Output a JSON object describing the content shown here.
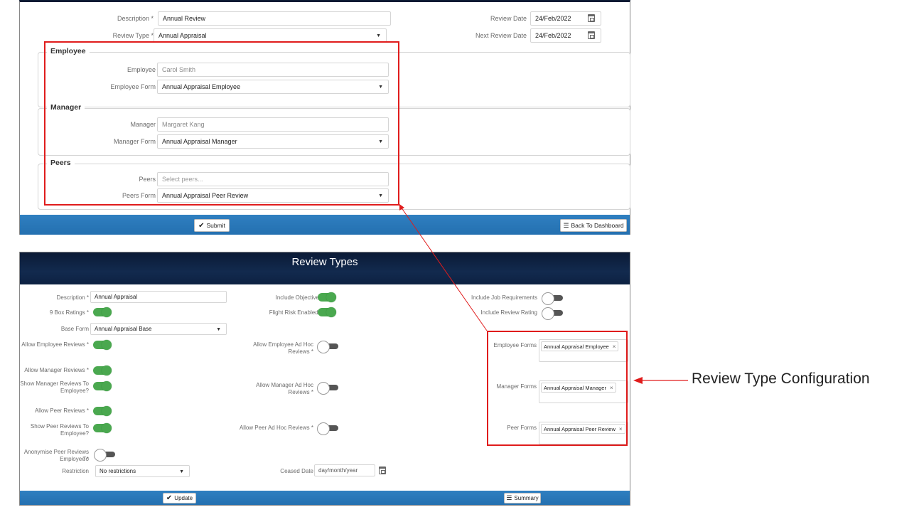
{
  "top_form": {
    "description_label": "Description *",
    "description_value": "Annual Review",
    "review_type_label": "Review Type *",
    "review_type_value": "Annual Appraisal",
    "review_date_label": "Review Date",
    "review_date_value": "24/Feb/2022",
    "next_review_date_label": "Next Review Date",
    "next_review_date_value": "24/Feb/2022",
    "employee_section": {
      "legend": "Employee",
      "employee_label": "Employee",
      "employee_value": "Carol Smith",
      "form_label": "Employee Form",
      "form_value": "Annual Appraisal Employee"
    },
    "manager_section": {
      "legend": "Manager",
      "manager_label": "Manager",
      "manager_value": "Margaret Kang",
      "form_label": "Manager Form",
      "form_value": "Annual Appraisal Manager"
    },
    "peers_section": {
      "legend": "Peers",
      "peers_label": "Peers",
      "peers_placeholder": "Select peers...",
      "form_label": "Peers Form",
      "form_value": "Annual Appraisal Peer Review"
    },
    "submit_label": "Submit",
    "back_label": "Back To Dashboard"
  },
  "review_types": {
    "title": "Review Types",
    "description_label": "Description *",
    "description_value": "Annual Appraisal",
    "nine_box_label": "9 Box Ratings *",
    "base_form_label": "Base Form",
    "base_form_value": "Annual Appraisal Base",
    "allow_employee_reviews_label": "Allow Employee Reviews *",
    "allow_manager_reviews_label": "Allow Manager Reviews *",
    "show_manager_reviews_label_1": "Show Manager Reviews To",
    "show_manager_reviews_label_2": "Employee?",
    "allow_peer_reviews_label": "Allow Peer Reviews *",
    "show_peer_reviews_label_1": "Show Peer Reviews To",
    "show_peer_reviews_label_2": "Employee?",
    "anonymise_label_1": "Anonymise Peer Reviews To",
    "anonymise_label_2": "Employee *",
    "restriction_label": "Restriction",
    "restriction_value": "No restrictions",
    "include_objectives_label": "Include Objectives",
    "flight_risk_label": "Flight Risk Enabled *",
    "allow_employee_adhoc_label_1": "Allow Employee Ad Hoc",
    "allow_employee_adhoc_label_2": "Reviews *",
    "allow_manager_adhoc_label_1": "Allow Manager Ad Hoc",
    "allow_manager_adhoc_label_2": "Reviews *",
    "allow_peer_adhoc_label": "Allow Peer Ad Hoc Reviews *",
    "ceased_date_label": "Ceased Date",
    "ceased_date_placeholder": "day/month/year",
    "include_job_req_label": "Include Job Requirements",
    "include_review_rating_label": "Include Review Rating",
    "employee_forms_label": "Employee Forms",
    "employee_forms_tag": "Annual Appraisal Employee",
    "manager_forms_label": "Manager Forms",
    "manager_forms_tag": "Annual Appraisal Manager",
    "peer_forms_label": "Peer Forms",
    "peer_forms_tag": "Annual Appraisal Peer Review",
    "update_label": "Update",
    "summary_label": "Summary",
    "remove_glyph": "×"
  },
  "annotation": {
    "label": "Review Type Configuration",
    "accent_color": "#e01c1c"
  }
}
